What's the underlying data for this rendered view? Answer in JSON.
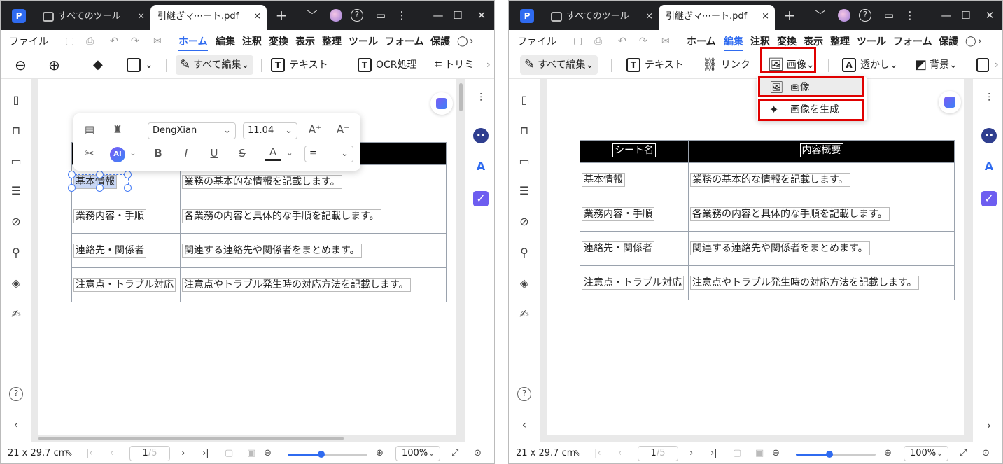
{
  "tabs": {
    "tools_label": "すべてのツール",
    "doc_label": "引継ぎマ⋯ート.pdf",
    "new_tab": "+",
    "close": "×"
  },
  "window_controls": {
    "dropdown": "﹀",
    "help": "?",
    "feedback": "▭",
    "more": "⋮",
    "minimize": "—",
    "maximize": "☐",
    "close": "✕"
  },
  "menu": {
    "file": "ファイル",
    "home": "ホーム",
    "edit": "編集",
    "annotate": "注釈",
    "convert": "変換",
    "view": "表示",
    "organize": "整理",
    "tools": "ツール",
    "form": "フォーム",
    "protect": "保護"
  },
  "window1": {
    "toolbar": {
      "edit_all": "すべて編集",
      "text": "テキスト",
      "ocr": "OCR処理",
      "crop": "トリミ"
    },
    "float_toolbar": {
      "font": "DengXian",
      "size": "11.04",
      "ai": "AI"
    }
  },
  "window2": {
    "toolbar": {
      "edit_all": "すべて編集",
      "text": "テキスト",
      "link": "リンク",
      "image": "画像",
      "watermark": "透かし",
      "background": "背景"
    },
    "dropdown": {
      "image": "画像",
      "generate": "画像を生成"
    }
  },
  "table": {
    "headers": [
      "シート名",
      "内容概要"
    ],
    "rows": [
      [
        "基本情報",
        "業務の基本的な情報を記載します。"
      ],
      [
        "業務内容・手順",
        "各業務の内容と具体的な手順を記載します。"
      ],
      [
        "連絡先・関係者",
        "関連する連絡先や関係者をまとめます。"
      ],
      [
        "注意点・トラブル対応",
        "注意点やトラブル発生時の対応方法を記載します。"
      ]
    ]
  },
  "status": {
    "size": "21 x 29.7 cm",
    "page": "1",
    "pages": "/5",
    "zoom": "100%"
  },
  "zoom_fraction": 0.42,
  "colors": {
    "accent": "#2f6bf0",
    "highlight_box": "#e00000",
    "header_bg": "#000000",
    "tabbar": "#202124"
  },
  "icons": [
    "zoom-out-icon",
    "zoom-in-icon",
    "eraser-icon",
    "shape-icon",
    "edit-all-icon",
    "text-icon",
    "ocr-icon",
    "crop-icon",
    "link-icon",
    "image-icon",
    "watermark-icon",
    "background-icon",
    "page-icon",
    "bookmark-icon",
    "comment-icon",
    "layers-icon",
    "attachment-icon",
    "search-icon",
    "stack-icon",
    "signature-icon",
    "help-icon",
    "settings-sliders-icon",
    "assistant-icon",
    "translate-icon",
    "check-icon"
  ]
}
